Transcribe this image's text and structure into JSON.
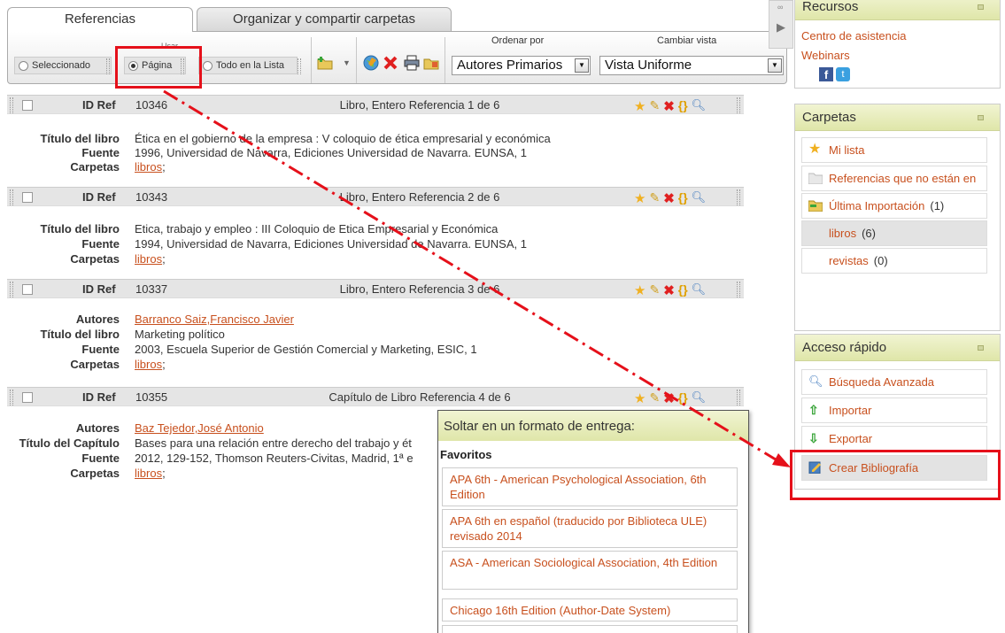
{
  "tabs": [
    "Referencias",
    "Organizar y compartir carpetas"
  ],
  "toolbar": {
    "usar_label": "Usar",
    "radios": [
      "Seleccionado",
      "Página",
      "Todo en la Lista"
    ],
    "selected_radio": "Página",
    "ordenar_label": "Ordenar por",
    "ordenar_value": "Autores Primarios",
    "cambiar_label": "Cambiar vista",
    "cambiar_value": "Vista Uniforme"
  },
  "references": [
    {
      "id_label": "ID Ref",
      "id": "10346",
      "type": "Libro, Entero Referencia 1 de 6",
      "fields": [
        {
          "label": "Título del libro",
          "value": "Ética en el gobierno de la empresa : V coloquio de ética empresarial y económica"
        },
        {
          "label": "Fuente",
          "value": "1996, Universidad de Navarra, Ediciones Universidad de Navarra. EUNSA, 1"
        },
        {
          "label": "Carpetas",
          "value": "libros",
          "suffix": ";"
        }
      ]
    },
    {
      "id_label": "ID Ref",
      "id": "10343",
      "type": "Libro, Entero Referencia 2 de 6",
      "fields": [
        {
          "label": "Título del libro",
          "value": "Etica, trabajo y empleo : III Coloquio de Etica Empresarial y Económica"
        },
        {
          "label": "Fuente",
          "value": "1994, Universidad de Navarra, Ediciones Universidad de Navarra. EUNSA, 1"
        },
        {
          "label": "Carpetas",
          "value": "libros",
          "suffix": ";"
        }
      ]
    },
    {
      "id_label": "ID Ref",
      "id": "10337",
      "type": "Libro, Entero Referencia 3 de 6",
      "fields": [
        {
          "label": "Autores",
          "value": "Barranco Saiz,Francisco Javier"
        },
        {
          "label": "Título del libro",
          "value": "Marketing político"
        },
        {
          "label": "Fuente",
          "value": "2003, Escuela Superior de Gestión Comercial y Marketing, ESIC, 1"
        },
        {
          "label": "Carpetas",
          "value": "libros",
          "suffix": ";"
        }
      ]
    },
    {
      "id_label": "ID Ref",
      "id": "10355",
      "type": "Capítulo de Libro Referencia 4 de 6",
      "fields": [
        {
          "label": "Autores",
          "value": "Baz Tejedor,José Antonio"
        },
        {
          "label": "Título del Capítulo",
          "value": "Bases para una relación entre derecho del trabajo y ét"
        },
        {
          "label": "Fuente",
          "value": "2012, 129-152, Thomson Reuters-Civitas, Madrid, 1ª e"
        },
        {
          "label": "Carpetas",
          "value": "libros",
          "suffix": ";"
        }
      ]
    }
  ],
  "recursos": {
    "title": "Recursos",
    "links": [
      "Centro de asistencia",
      "Webinars"
    ]
  },
  "carpetas": {
    "title": "Carpetas",
    "items": [
      {
        "label": "Mi lista",
        "count": ""
      },
      {
        "label": "Referencias que no están en",
        "count": ""
      },
      {
        "label": "Última Importación",
        "count": "(1)"
      },
      {
        "label": "libros",
        "count": "(6)"
      },
      {
        "label": "revistas",
        "count": "(0)"
      }
    ]
  },
  "acceso": {
    "title": "Acceso rápido",
    "items": [
      "Búsqueda Avanzada",
      "Importar",
      "Exportar",
      "Crear Bibliografía"
    ]
  },
  "popup": {
    "title": "Soltar en un formato de entrega:",
    "subtitle": "Favoritos",
    "items": [
      "APA 6th - American Psychological Association, 6th Edition",
      "APA 6th en español (traducido por Biblioteca ULE) revisado 2014",
      "ASA - American Sociological Association, 4th Edition",
      "Chicago 16th Edition (Author-Date System)"
    ]
  },
  "colors": {
    "accent": "#c8501e",
    "annotation": "#e5101a",
    "panel_header": "#dfe6a9"
  }
}
